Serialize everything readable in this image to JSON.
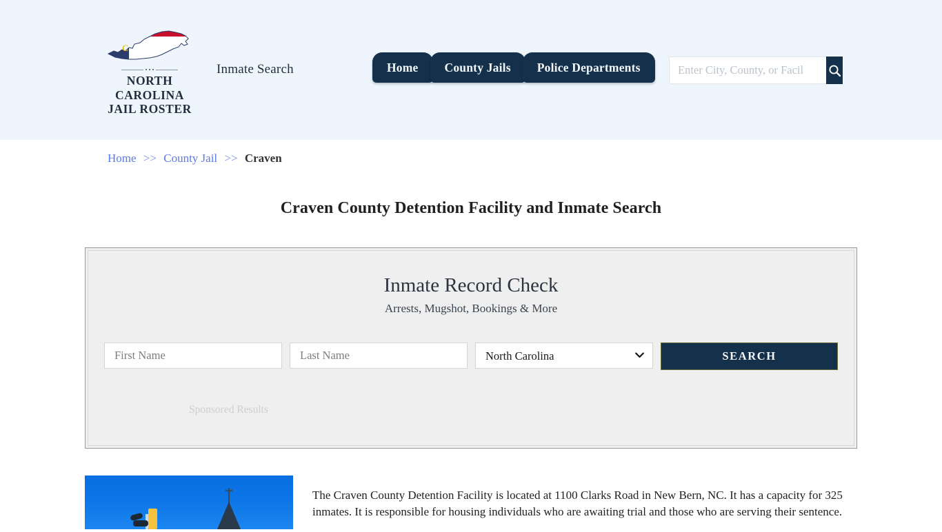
{
  "header": {
    "brand": {
      "line1": "NORTH CAROLINA",
      "line2": "JAIL ROSTER",
      "logo_icon": "north-carolina-state-map-flag-icon",
      "flag_navy": "#2c3c6b",
      "flag_red": "#c8102e",
      "flag_white": "#ffffff",
      "monogram": "C"
    },
    "tagline": "Inmate Search",
    "background_color": "#eef5fd",
    "nav": [
      {
        "label": "Home"
      },
      {
        "label": "County Jails"
      },
      {
        "label": "Police Departments"
      }
    ],
    "search": {
      "value": "",
      "placeholder": "Enter City, County, or Facil",
      "button_icon": "search-icon",
      "button_color": "#14304a"
    }
  },
  "breadcrumb": {
    "items": [
      {
        "label": "Home",
        "link": true
      },
      {
        "label": "County Jail",
        "link": true
      },
      {
        "label": "Craven",
        "link": false
      }
    ],
    "separator": ">>",
    "link_color": "#5b79e8"
  },
  "page_title": "Craven County Detention Facility and Inmate Search",
  "record_check": {
    "title": "Inmate Record Check",
    "subtitle": "Arrests, Mugshot, Bookings & More",
    "first_name": {
      "value": "",
      "placeholder": "First Name"
    },
    "last_name": {
      "value": "",
      "placeholder": "Last Name"
    },
    "state_select": {
      "selected": "North Carolina",
      "options": [
        "North Carolina"
      ],
      "chevron_icon": "chevron-down-icon"
    },
    "search_button": "SEARCH",
    "sponsored_label": "Sponsored Results",
    "panel_bg": "#efefef",
    "panel_border": "#9a9a9a"
  },
  "facility": {
    "image_alt": "craven-county-photo",
    "description": "The Craven County Detention Facility is located at 1100 Clarks Road in New Bern, NC. It has a capacity for 325 inmates. It is responsible for housing individuals who are awaiting trial and those who are serving their sentence."
  }
}
